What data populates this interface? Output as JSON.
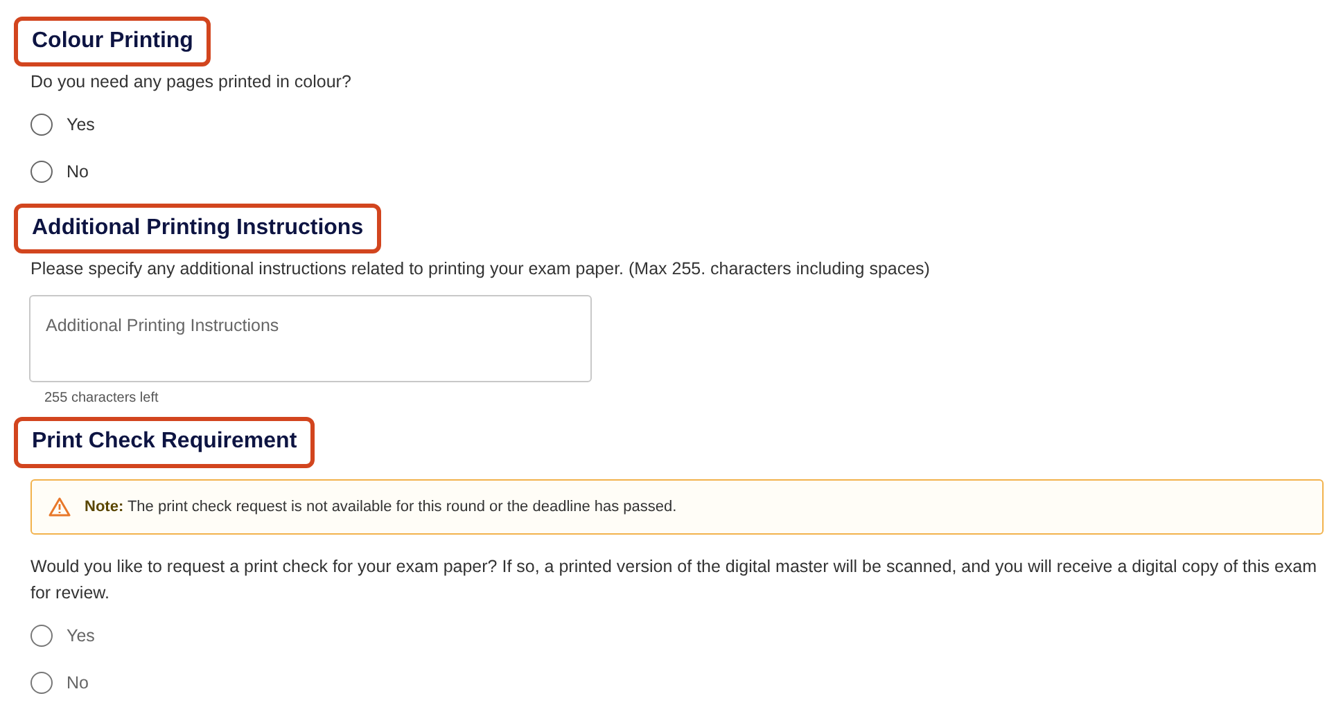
{
  "sections": [
    {
      "kind": "radio",
      "heading": "Colour Printing",
      "highlighted": true,
      "question": "Do you need any pages printed in colour?",
      "options": [
        {
          "label": "Yes",
          "selected": false,
          "disabled": false
        },
        {
          "label": "No",
          "selected": false,
          "disabled": false
        }
      ]
    },
    {
      "kind": "text",
      "heading": "Additional Printing Instructions",
      "highlighted": true,
      "question": "Please specify any additional instructions related to printing your exam paper. (Max 255. characters including spaces)",
      "placeholder": "Additional Printing Instructions",
      "counter": "255 characters left"
    },
    {
      "kind": "radio",
      "heading": "Print Check Requirement",
      "highlighted": true,
      "alert": {
        "label": "Note:",
        "text": "The print check request is not available for this round or the deadline has passed."
      },
      "question": "Would you like to request a print check for your exam paper? If so, a printed version of the digital master will be scanned, and you will receive a digital copy of this exam for review.",
      "options": [
        {
          "label": "Yes",
          "selected": false,
          "disabled": true
        },
        {
          "label": "No",
          "selected": false,
          "disabled": true
        }
      ]
    }
  ]
}
